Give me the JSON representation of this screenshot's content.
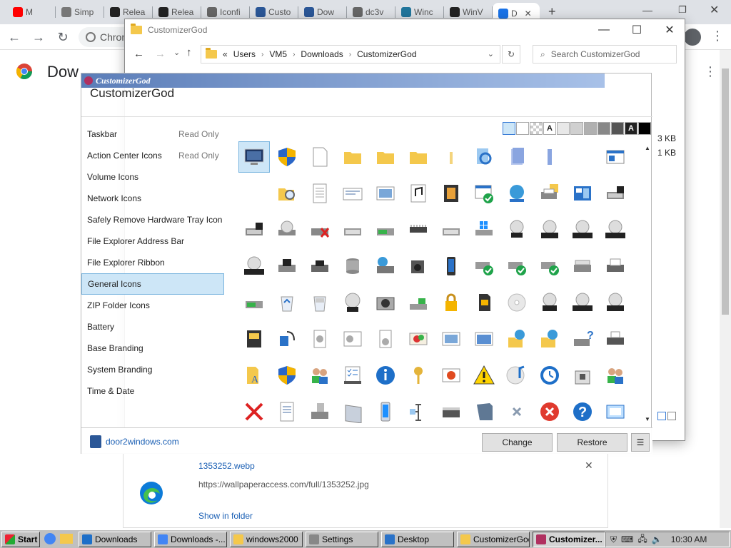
{
  "chrome": {
    "tabs": [
      {
        "label": "M",
        "fav": "youtube-icon",
        "color": "#ff0000"
      },
      {
        "label": "Simp",
        "fav": "page-icon",
        "color": "#777777"
      },
      {
        "label": "Relea",
        "fav": "github-icon",
        "color": "#222222"
      },
      {
        "label": "Relea",
        "fav": "github-icon",
        "color": "#222222"
      },
      {
        "label": "Iconfi",
        "fav": "globe-icon",
        "color": "#666666"
      },
      {
        "label": "Custo",
        "fav": "app-icon",
        "color": "#2b5797"
      },
      {
        "label": "Dow",
        "fav": "app-icon",
        "color": "#2b5797"
      },
      {
        "label": "dc3v",
        "fav": "globe-icon",
        "color": "#666666"
      },
      {
        "label": "Winc",
        "fav": "wordpress-icon",
        "color": "#21759b"
      },
      {
        "label": "WinV",
        "fav": "w-icon",
        "color": "#222222"
      },
      {
        "label": "D",
        "fav": "download-icon",
        "color": "#1a73e8"
      }
    ],
    "omnibox_text": "Chron",
    "page_heading": "Dow"
  },
  "explorer": {
    "title": "CustomizerGod",
    "breadcrumb_prefix": "«",
    "breadcrumb": [
      "Users",
      "VM5",
      "Downloads",
      "CustomizerGod"
    ],
    "search_placeholder": "Search CustomizerGod",
    "sizes": [
      "3 KB",
      "1 KB"
    ]
  },
  "customizergod": {
    "titlebar": "CustomizerGod",
    "app_title": "CustomizerGod",
    "sidebar": [
      {
        "label": "Taskbar",
        "note": "Read Only"
      },
      {
        "label": "Action Center Icons",
        "note": "Read Only"
      },
      {
        "label": "Volume Icons",
        "note": ""
      },
      {
        "label": "Network Icons",
        "note": ""
      },
      {
        "label": "Safely Remove Hardware Tray Icon",
        "note": ""
      },
      {
        "label": "File Explorer Address Bar",
        "note": ""
      },
      {
        "label": "File Explorer Ribbon",
        "note": ""
      },
      {
        "label": "General Icons",
        "note": "",
        "selected": true
      },
      {
        "label": "ZIP Folder Icons",
        "note": ""
      },
      {
        "label": "Battery",
        "note": ""
      },
      {
        "label": "Base Branding",
        "note": ""
      },
      {
        "label": "System Branding",
        "note": ""
      },
      {
        "label": "Time & Date",
        "note": ""
      }
    ],
    "swatches": [
      "#cde6f7",
      "#ffffff",
      "checker",
      "A-light",
      "#e8e8e8",
      "#d0d0d0",
      "#b0b0b0",
      "#888888",
      "#555555",
      "A-dark",
      "#000000"
    ],
    "icons": [
      "monitor",
      "shield",
      "blank-page",
      "folder",
      "folder",
      "folder",
      "folder-thin",
      "magnifier-file",
      "file-stack",
      "file-thin",
      "",
      "window",
      "",
      "folder-search",
      "text-doc",
      "envelope",
      "picture",
      "music-doc",
      "video-doc",
      "program-check",
      "globe-network",
      "printer-folder",
      "control-panel",
      "drive-save",
      "drive-save",
      "drive-disc",
      "drive-x",
      "drive",
      "drive-green",
      "chip",
      "drive",
      "windows-drive",
      "dvd-drive",
      "dvd-r",
      "dvd-ram",
      "dvd-rom",
      "dvd-rw",
      "floppy",
      "drive-dark",
      "drive-cylinder",
      "scanner-globe",
      "camcorder",
      "phone",
      "drive-check",
      "drive-check",
      "drive-check",
      "scanner",
      "printer",
      "drive-green",
      "recycle-empty",
      "recycle-full",
      "dvd",
      "camera",
      "usb-drive",
      "lock",
      "sdcard",
      "disc",
      "cd-r",
      "cd-rom",
      "cd-rw",
      "id-card",
      "phone-headset",
      "gear-doc",
      "gear-window",
      "gear-page",
      "paint",
      "picture",
      "window-landscape",
      "folder-globe",
      "folder-globe",
      "help-printer",
      "fax",
      "font-folder",
      "uac-shield",
      "users",
      "checklist",
      "info",
      "key",
      "photo",
      "warning",
      "music-disc",
      "clock",
      "briefcase",
      "users",
      "red-x",
      "page-doc",
      "drive-lock",
      "drive-panel",
      "phone-blue",
      "tool",
      "scanner-flat",
      "book",
      "small-x",
      "red-x-circle",
      "help-circle",
      "window-frame"
    ],
    "footer_link": "door2windows.com",
    "change_label": "Change",
    "restore_label": "Restore",
    "menu_label": "☰"
  },
  "download": {
    "filename": "1353252.webp",
    "url": "https://wallpaperaccess.com/full/1353252.jpg",
    "show_in_folder": "Show in folder"
  },
  "taskbar": {
    "start": "Start",
    "buttons": [
      "Downloads",
      "Downloads -...",
      "windows2000",
      "Settings",
      "Desktop",
      "CustomizerGod",
      "Customizer..."
    ],
    "clock": "10:30 AM"
  }
}
